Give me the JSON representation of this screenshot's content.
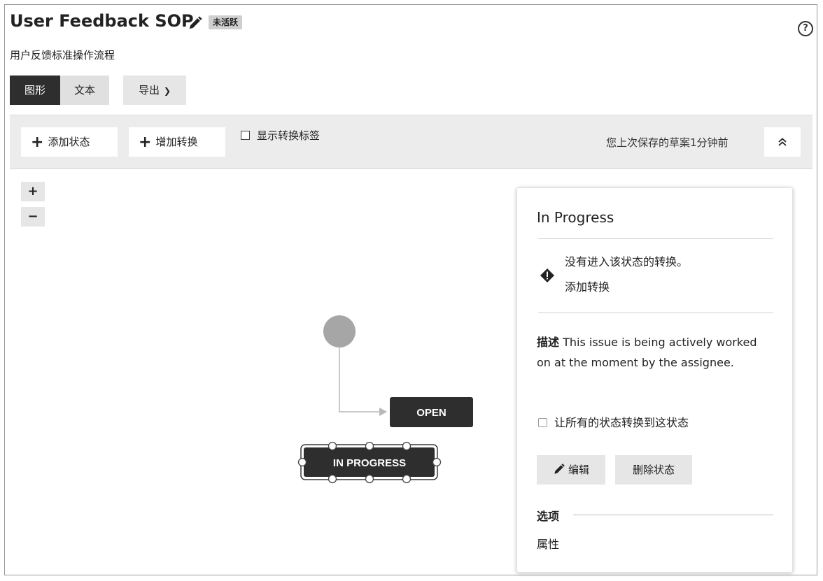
{
  "header": {
    "title": "User Feedback SOP",
    "status_badge": "未活跃",
    "subtitle": "用户反馈标准操作流程"
  },
  "view_tabs": [
    {
      "label": "图形",
      "active": true
    },
    {
      "label": "文本",
      "active": false
    }
  ],
  "export": {
    "label": "导出"
  },
  "toolbar": {
    "add_state": "添加状态",
    "add_transition": "增加转换",
    "show_labels": "显示转换标签",
    "show_labels_checked": false,
    "saved_text": "您上次保存的草案1分钟前"
  },
  "zoom": {
    "in": "+",
    "out": "−"
  },
  "diagram": {
    "nodes": [
      {
        "id": "start",
        "type": "initial"
      },
      {
        "id": "open",
        "label": "OPEN",
        "selected": false
      },
      {
        "id": "in-progress",
        "label": "IN PROGRESS",
        "selected": true
      }
    ],
    "transitions": [
      {
        "from": "start",
        "to": "open"
      }
    ]
  },
  "panel": {
    "title": "In Progress",
    "warning_text": "没有进入该状态的转换。",
    "warning_link": "添加转换",
    "description_label": "描述",
    "description": "This issue is being actively worked on at the moment by the assignee.",
    "allow_all_label": "让所有的状态转换到这状态",
    "allow_all_checked": false,
    "edit_button": "编辑",
    "delete_button": "删除状态",
    "options_label": "选项",
    "properties_label": "属性"
  },
  "colors": {
    "dark": "#2e2e2e",
    "toolbar_bg": "#ececec",
    "button_bg": "#e6e6e6",
    "start_circle": "#a6a6a6",
    "connector": "#b8b8b8"
  }
}
